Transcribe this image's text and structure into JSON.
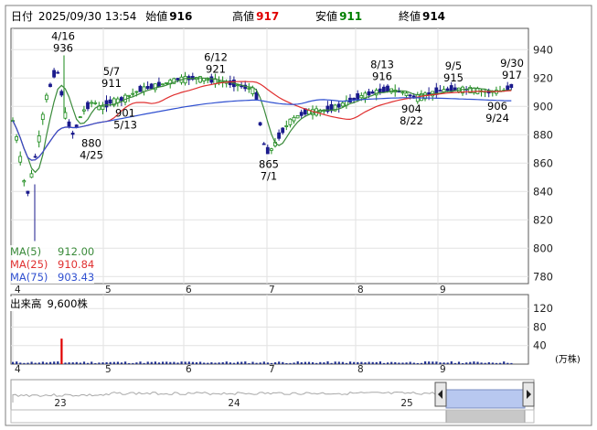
{
  "header": {
    "date_label": "日付",
    "datetime": "2025/09/30 13:54",
    "open_label": "始値",
    "open_value": "916",
    "high_label": "高値",
    "high_value": "917",
    "low_label": "安値",
    "low_value": "911",
    "close_label": "終値",
    "close_value": "914"
  },
  "legend": {
    "ma5_label": "MA(5)",
    "ma5_value": "912.00",
    "ma25_label": "MA(25)",
    "ma25_value": "910.84",
    "ma75_label": "MA(75)",
    "ma75_value": "903.43"
  },
  "volume_label": "出来高",
  "volume_value": "9,600株",
  "volume_unit": "(万株)",
  "colors": {
    "up": "#1a8a1a",
    "down": "#1a1a8c",
    "ma5": "#3a8a3a",
    "ma25": "#e03030",
    "ma75": "#3050d0",
    "high": "#e00000",
    "low": "#008000",
    "volume": "#203090",
    "spike": "#e00000",
    "navigator_fill": "#b8c8f0"
  },
  "chart_data": {
    "type": "candlestick",
    "y_ticks": [
      780,
      800,
      820,
      840,
      860,
      880,
      900,
      920,
      940
    ],
    "ylim": [
      775,
      955
    ],
    "month_ticks": [
      "4",
      "5",
      "6",
      "7",
      "8",
      "9"
    ],
    "volume_ticks": [
      40,
      80,
      120
    ],
    "volume_ylim": [
      0,
      150
    ],
    "navigator_ticks": [
      "23",
      "24",
      "25"
    ],
    "annotations": [
      {
        "label": "4/16",
        "value": "936",
        "pos": "above"
      },
      {
        "label": "4/25",
        "value": "880",
        "pos": "below"
      },
      {
        "label": "5/7",
        "value": "911",
        "pos": "above"
      },
      {
        "label": "5/13",
        "value": "901",
        "pos": "below"
      },
      {
        "label": "6/12",
        "value": "921",
        "pos": "above"
      },
      {
        "label": "7/1",
        "value": "865",
        "pos": "below"
      },
      {
        "label": "8/13",
        "value": "916",
        "pos": "above"
      },
      {
        "label": "8/22",
        "value": "904",
        "pos": "below"
      },
      {
        "label": "9/5",
        "value": "915",
        "pos": "above"
      },
      {
        "label": "9/24",
        "value": "906",
        "pos": "below"
      },
      {
        "label": "9/30",
        "value": "917",
        "pos": "above"
      }
    ]
  }
}
